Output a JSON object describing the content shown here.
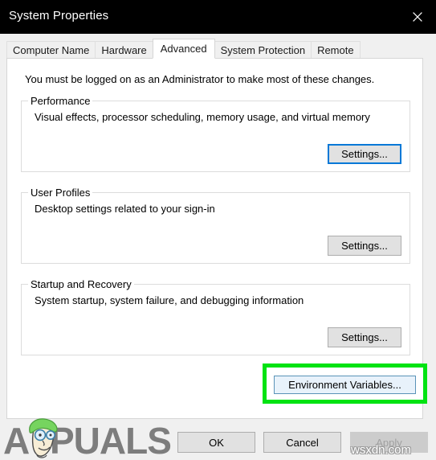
{
  "window": {
    "title": "System Properties",
    "close_icon": "close-icon"
  },
  "tabs": [
    {
      "label": "Computer Name",
      "selected": false
    },
    {
      "label": "Hardware",
      "selected": false
    },
    {
      "label": "Advanced",
      "selected": true
    },
    {
      "label": "System Protection",
      "selected": false
    },
    {
      "label": "Remote",
      "selected": false
    }
  ],
  "advanced": {
    "admin_note": "You must be logged on as an Administrator to make most of these changes.",
    "groups": [
      {
        "legend": "Performance",
        "description": "Visual effects, processor scheduling, memory usage, and virtual memory",
        "button_label": "Settings...",
        "button_state": "focused"
      },
      {
        "legend": "User Profiles",
        "description": "Desktop settings related to your sign-in",
        "button_label": "Settings...",
        "button_state": "normal"
      },
      {
        "legend": "Startup and Recovery",
        "description": "System startup, system failure, and debugging information",
        "button_label": "Settings...",
        "button_state": "normal"
      }
    ],
    "environment_variables": {
      "button_label": "Environment Variables...",
      "button_state": "hovered",
      "highlight_color": "#00e312"
    }
  },
  "actions": {
    "ok_label": "OK",
    "cancel_label": "Cancel",
    "apply_label": "Apply",
    "apply_enabled": false
  },
  "watermarks": {
    "brand_text": "APPUALS",
    "site_text": "wsxdn.com"
  }
}
